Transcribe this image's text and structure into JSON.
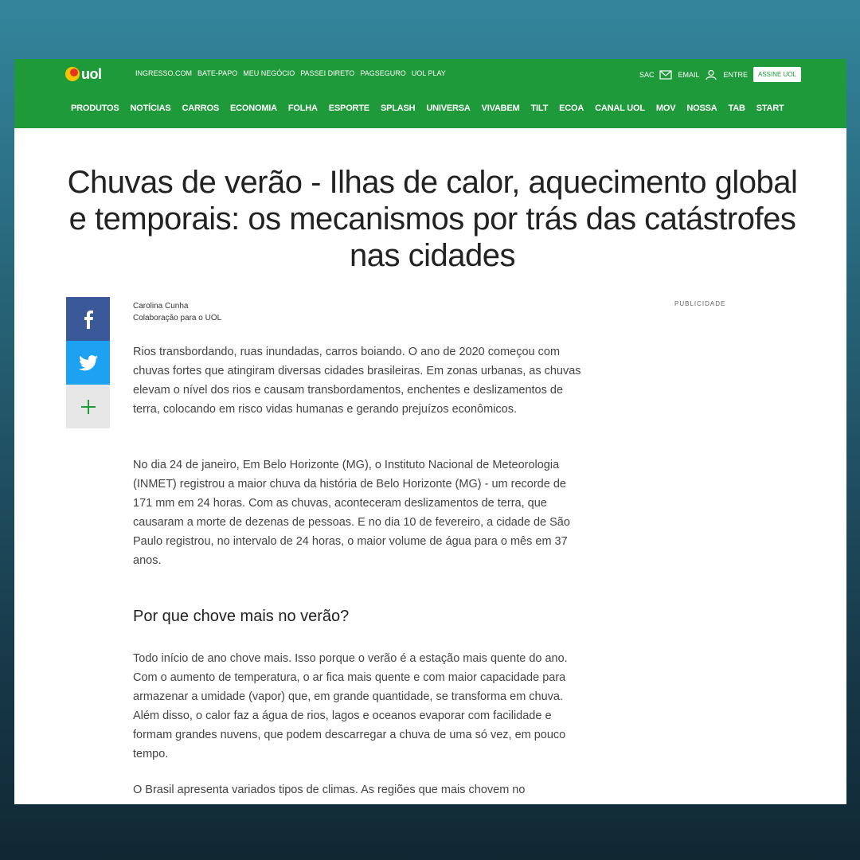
{
  "header": {
    "logo_text": "uol",
    "top_links": [
      "INGRESSO.COM",
      "BATE-PAPO",
      "MEU NEGÓCIO",
      "PASSEI DIRETO",
      "PAGSEGURO",
      "UOL PLAY"
    ],
    "sac": "SAC",
    "email": "EMAIL",
    "entre": "ENTRE",
    "assine": "ASSINE UOL",
    "nav": [
      "PRODUTOS",
      "NOTÍCIAS",
      "CARROS",
      "ECONOMIA",
      "FOLHA",
      "ESPORTE",
      "SPLASH",
      "UNIVERSA",
      "VIVABEM",
      "TILT",
      "ECOA",
      "CANAL UOL",
      "MOV",
      "NOSSA",
      "TAB",
      "START"
    ],
    "colors": {
      "green": "#1f9a3a",
      "facebook": "#3b5998",
      "twitter": "#1da1f2"
    }
  },
  "article": {
    "title": "Chuvas de verão - Ilhas de calor, aquecimento global e temporais: os mecanismos por trás das catástrofes nas cidades",
    "author": "Carolina Cunha",
    "author_role": "Colaboração para o UOL",
    "publicidade": "PUBLICIDADE",
    "p1": "Rios transbordando, ruas inundadas, carros boiando. O ano de 2020 começou com chuvas fortes que atingiram diversas cidades brasileiras. Em zonas urbanas, as chuvas elevam o nível dos rios e causam transbordamentos, enchentes e deslizamentos de terra, colocando em risco vidas humanas e gerando prejuízos econômicos.",
    "p2": "No dia 24 de janeiro, Em Belo Horizonte (MG), o Instituto Nacional de Meteorologia (INMET) registrou a maior chuva da história de Belo Horizonte (MG) - um recorde de 171 mm em 24 horas. Com as chuvas, aconteceram deslizamentos de terra, que causaram a morte de dezenas de pessoas. E no dia 10 de fevereiro, a cidade de São Paulo registrou, no intervalo de 24 horas, o maior volume de água para o mês em 37 anos.",
    "h2": "Por que chove mais no verão?",
    "p3": "Todo início de ano chove mais. Isso porque o verão é a estação mais quente do ano. Com o aumento de temperatura, o ar fica mais quente e com maior capacidade para armazenar a umidade (vapor) que, em grande quantidade, se transforma em chuva. Além disso, o calor faz a água de rios, lagos e oceanos evaporar com facilidade e formam grandes nuvens, que podem descarregar a chuva de uma só vez, em pouco tempo.",
    "p4": "O Brasil apresenta variados tipos de climas. As regiões que mais chovem no"
  },
  "share": {
    "icons": [
      "facebook-icon",
      "twitter-icon",
      "plus-icon"
    ]
  }
}
